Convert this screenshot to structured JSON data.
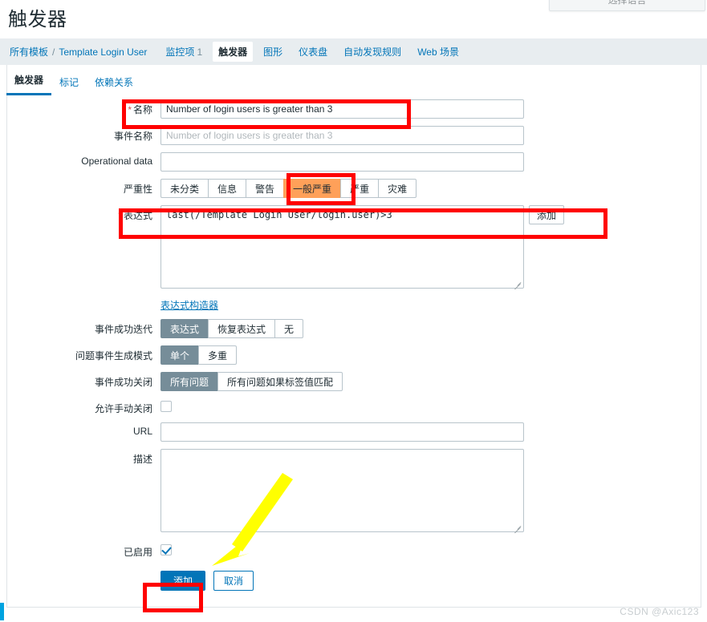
{
  "window": {
    "language_selector": "选择语言",
    "watermark": "CSDN @Axic123"
  },
  "header": {
    "title": "触发器"
  },
  "breadcrumb": {
    "root": "所有模板",
    "separator": "/",
    "template": "Template Login User"
  },
  "object_nav": {
    "items": [
      {
        "label": "监控项",
        "count": "1",
        "active": false
      },
      {
        "label": "触发器",
        "count": "",
        "active": true
      },
      {
        "label": "图形",
        "count": "",
        "active": false
      },
      {
        "label": "仪表盘",
        "count": "",
        "active": false
      },
      {
        "label": "自动发现规则",
        "count": "",
        "active": false
      },
      {
        "label": "Web 场景",
        "count": "",
        "active": false
      }
    ]
  },
  "tabs": [
    {
      "label": "触发器",
      "active": true
    },
    {
      "label": "标记",
      "active": false
    },
    {
      "label": "依赖关系",
      "active": false
    }
  ],
  "form": {
    "name": {
      "label": "名称",
      "required": true,
      "value": "Number of login users is greater than 3"
    },
    "event_name": {
      "label": "事件名称",
      "value": "",
      "placeholder": "Number of login users is greater than 3"
    },
    "operational_data": {
      "label": "Operational data",
      "value": "",
      "placeholder": ""
    },
    "severity": {
      "label": "严重性",
      "options": [
        "未分类",
        "信息",
        "警告",
        "一般严重",
        "严重",
        "灾难"
      ],
      "selected": "一般严重"
    },
    "expression": {
      "label": "表达式",
      "required": true,
      "value": "last(/Template Login User/login.user)>3",
      "add_button": "添加",
      "constructor_link": "表达式构造器"
    },
    "recovery_mode": {
      "label": "事件成功迭代",
      "options": [
        "表达式",
        "恢复表达式",
        "无"
      ],
      "selected": "表达式"
    },
    "problem_event_generation": {
      "label": "问题事件生成模式",
      "options": [
        "单个",
        "多重"
      ],
      "selected": "单个"
    },
    "event_close": {
      "label": "事件成功关闭",
      "options": [
        "所有问题",
        "所有问题如果标签值匹配"
      ],
      "selected": "所有问题"
    },
    "allow_manual_close": {
      "label": "允许手动关闭",
      "checked": false
    },
    "url": {
      "label": "URL",
      "value": ""
    },
    "description": {
      "label": "描述",
      "value": ""
    },
    "enabled": {
      "label": "已启用",
      "checked": true
    }
  },
  "footer": {
    "submit": "添加",
    "cancel": "取消"
  },
  "colors": {
    "accent": "#0275b8",
    "severity_average": "#ffa059",
    "selected_segment": "#768d99",
    "annotation": "#ff0000",
    "arrow": "#ffff00"
  }
}
